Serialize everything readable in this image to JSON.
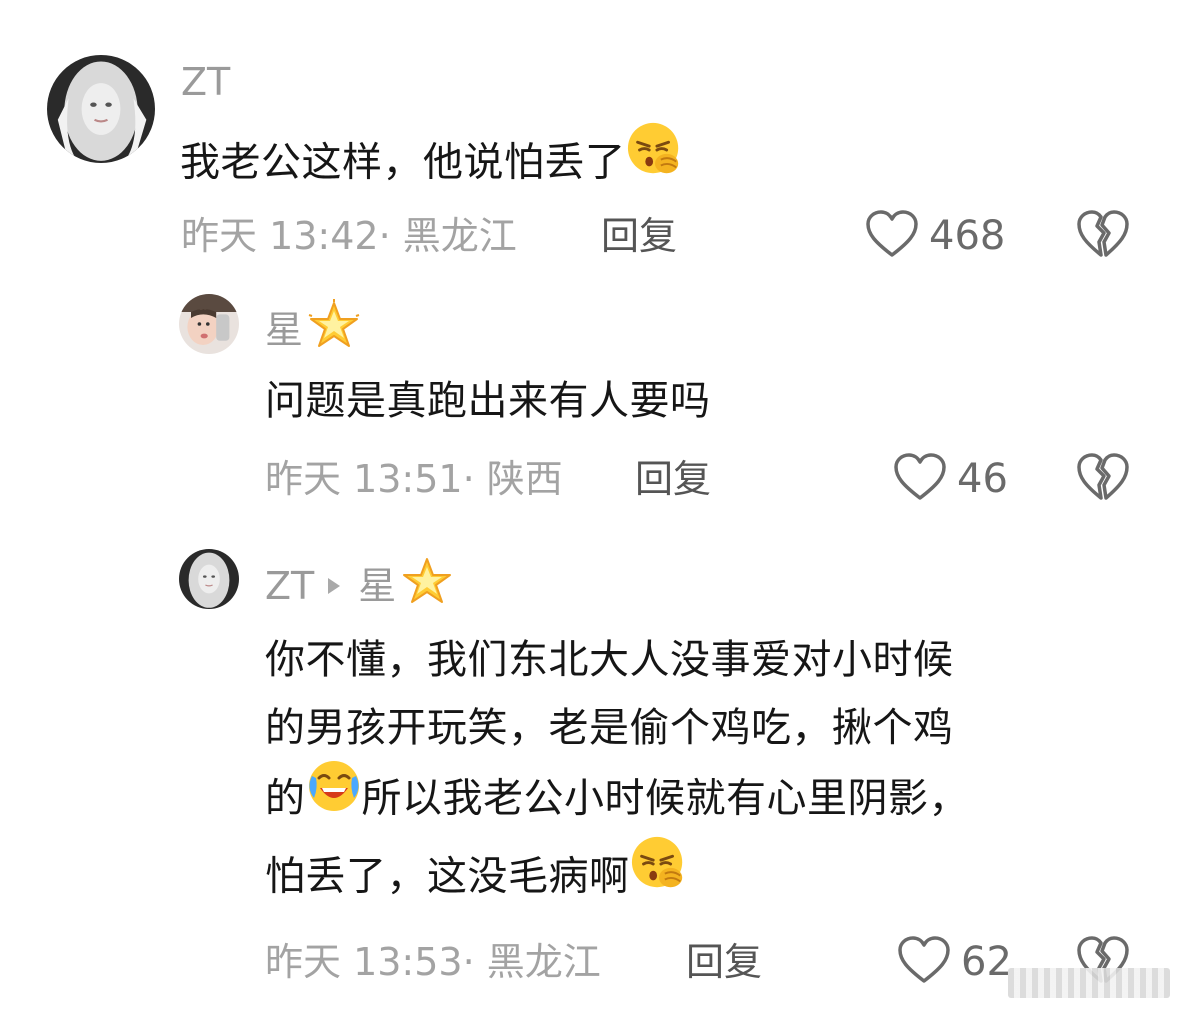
{
  "comments": [
    {
      "username": "ZT",
      "text_lines": [
        "我老公这样，他说怕丢了"
      ],
      "timestamp": "昨天 13:42· 黑龙江",
      "reply_label": "回复",
      "likes": "468",
      "emoji": "shushing-face"
    },
    {
      "username": "星",
      "username_emoji": "glowing-star",
      "text_lines": [
        "问题是真跑出来有人要吗"
      ],
      "timestamp": "昨天 13:51· 陕西",
      "reply_label": "回复",
      "likes": "46"
    },
    {
      "username": "ZT",
      "reply_to": "星",
      "reply_to_emoji": "glowing-star",
      "text_lines": [
        "你不懂，我们东北大人没事爱对小时候",
        "的男孩开玩笑，老是偷个鸡吃，揪个鸡",
        "的",
        "所以我老公小时候就有心里阴影，",
        "怕丢了，这没毛病啊"
      ],
      "timestamp": "昨天 13:53· 黑龙江",
      "reply_label": "回复",
      "likes": "62"
    }
  ],
  "colors": {
    "meta_gray": "#a3a3a3",
    "username_gray": "#9a9a9a",
    "text": "#161616",
    "icon_gray": "#6a6a6a"
  }
}
